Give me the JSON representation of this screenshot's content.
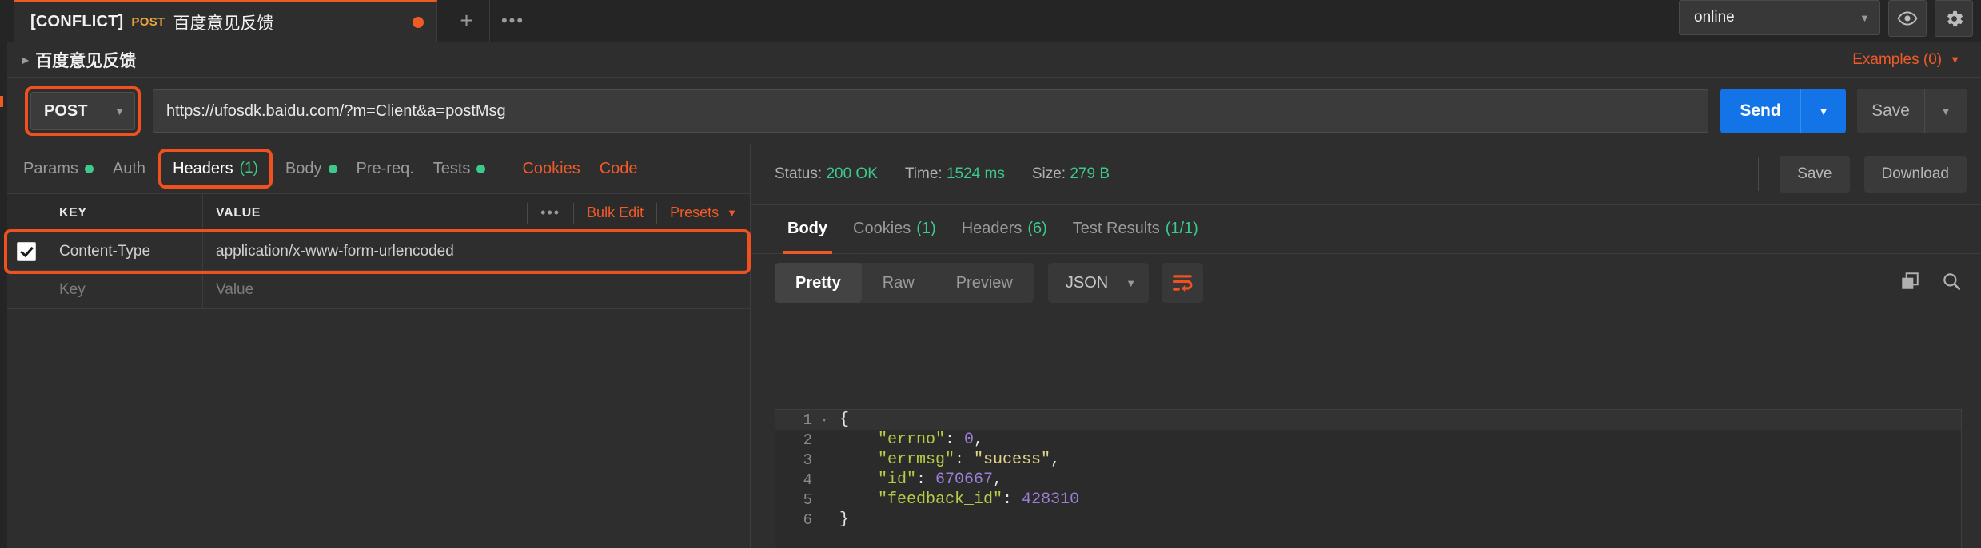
{
  "tabstrip": {
    "tab": {
      "conflict_label": "[CONFLICT]",
      "method": "POST",
      "name": "百度意见反馈",
      "unsaved_icon": "unsaved-dot"
    },
    "new_tab_label": "+",
    "more_label": "•••"
  },
  "environment": {
    "selected": "online",
    "caret": "▼",
    "eye_icon": "eye-icon",
    "gear_icon": "gear-icon"
  },
  "breadcrumb": {
    "caret": "▶",
    "title": "百度意见反馈",
    "examples_label": "Examples (0)",
    "examples_caret": "▼"
  },
  "urlbar": {
    "method": "POST",
    "method_caret": "▼",
    "url": "https://ufosdk.baidu.com/?m=Client&a=postMsg",
    "send_label": "Send",
    "send_caret": "▼",
    "save_label": "Save",
    "save_caret": "▼"
  },
  "request_tabs": [
    {
      "label": "Params",
      "dot": true,
      "count": "",
      "active": false,
      "accent": false
    },
    {
      "label": "Auth",
      "dot": false,
      "count": "",
      "active": false,
      "accent": false
    },
    {
      "label": "Headers",
      "dot": false,
      "count": "(1)",
      "active": true,
      "accent": false
    },
    {
      "label": "Body",
      "dot": true,
      "count": "",
      "active": false,
      "accent": false
    },
    {
      "label": "Pre-req.",
      "dot": false,
      "count": "",
      "active": false,
      "accent": false
    },
    {
      "label": "Tests",
      "dot": true,
      "count": "",
      "active": false,
      "accent": false
    },
    {
      "label": "Cookies",
      "dot": false,
      "count": "",
      "active": false,
      "accent": true
    },
    {
      "label": "Code",
      "dot": false,
      "count": "",
      "active": false,
      "accent": true
    }
  ],
  "headers_table": {
    "columns": {
      "key": "KEY",
      "value": "VALUE"
    },
    "tools": {
      "dots": "•••",
      "bulk_edit": "Bulk Edit",
      "presets": "Presets",
      "presets_caret": "▼"
    },
    "rows": [
      {
        "checked": true,
        "key": "Content-Type",
        "value": "application/x-www-form-urlencoded"
      }
    ],
    "placeholder_row": {
      "key": "Key",
      "value": "Value"
    }
  },
  "response": {
    "status_label": "Status:",
    "status_value": "200 OK",
    "time_label": "Time:",
    "time_value": "1524 ms",
    "size_label": "Size:",
    "size_value": "279 B",
    "save_label": "Save",
    "download_label": "Download",
    "tabs": [
      {
        "label": "Body",
        "count": "",
        "active": true
      },
      {
        "label": "Cookies",
        "count": "(1)",
        "active": false
      },
      {
        "label": "Headers",
        "count": "(6)",
        "active": false
      },
      {
        "label": "Test Results",
        "count": "(1/1)",
        "active": false
      }
    ],
    "viewer": {
      "modes": [
        {
          "label": "Pretty",
          "active": true
        },
        {
          "label": "Raw",
          "active": false
        },
        {
          "label": "Preview",
          "active": false
        }
      ],
      "format": "JSON",
      "format_caret": "▼",
      "wrap_icon": "word-wrap-icon",
      "copy_icon": "copy-icon",
      "search_icon": "search-icon"
    },
    "body_lines": [
      {
        "num": "1",
        "fold": "▾",
        "tokens": [
          {
            "t": "{",
            "c": "j-pun"
          }
        ]
      },
      {
        "num": "2",
        "fold": "",
        "tokens": [
          {
            "t": "    \"errno\"",
            "c": "j-key"
          },
          {
            "t": ": ",
            "c": "j-pun"
          },
          {
            "t": "0",
            "c": "j-num"
          },
          {
            "t": ",",
            "c": "j-pun"
          }
        ]
      },
      {
        "num": "3",
        "fold": "",
        "tokens": [
          {
            "t": "    \"errmsg\"",
            "c": "j-key"
          },
          {
            "t": ": ",
            "c": "j-pun"
          },
          {
            "t": "\"sucess\"",
            "c": "j-str"
          },
          {
            "t": ",",
            "c": "j-pun"
          }
        ]
      },
      {
        "num": "4",
        "fold": "",
        "tokens": [
          {
            "t": "    \"id\"",
            "c": "j-key"
          },
          {
            "t": ": ",
            "c": "j-pun"
          },
          {
            "t": "670667",
            "c": "j-num"
          },
          {
            "t": ",",
            "c": "j-pun"
          }
        ]
      },
      {
        "num": "5",
        "fold": "",
        "tokens": [
          {
            "t": "    \"feedback_id\"",
            "c": "j-key"
          },
          {
            "t": ": ",
            "c": "j-pun"
          },
          {
            "t": "428310",
            "c": "j-num"
          }
        ]
      },
      {
        "num": "6",
        "fold": "",
        "tokens": [
          {
            "t": "}",
            "c": "j-pun"
          }
        ]
      }
    ]
  },
  "colors": {
    "accent_orange": "#f05a28",
    "highlight_box": "#f0511f",
    "send_blue": "#1374e8",
    "status_green": "#3dc98b",
    "method_amber": "#e8a33d"
  }
}
